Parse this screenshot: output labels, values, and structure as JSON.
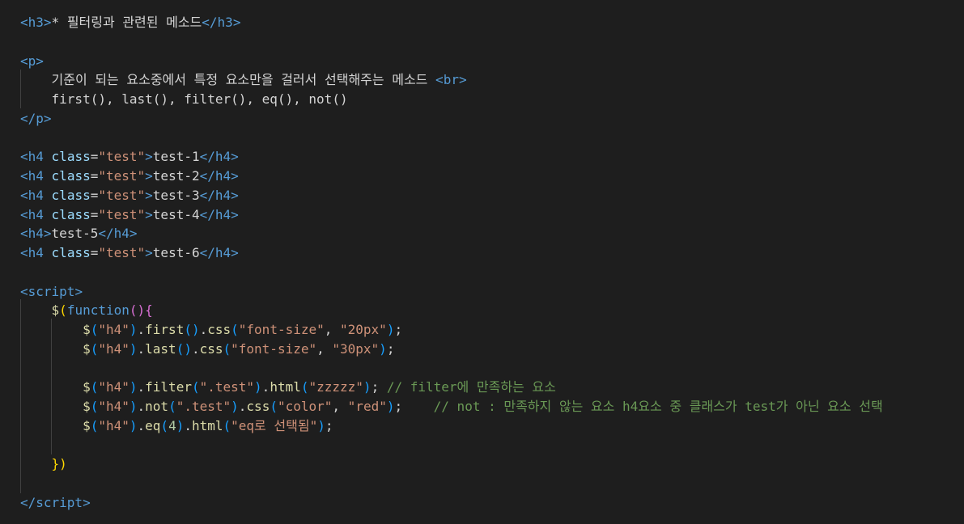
{
  "editor": {
    "lines": [
      {
        "segments": [
          {
            "t": "<",
            "c": "tag"
          },
          {
            "t": "h3",
            "c": "tag"
          },
          {
            "t": ">",
            "c": "tag"
          },
          {
            "t": "* 필터링과 관련된 메소드",
            "c": "txt"
          },
          {
            "t": "</",
            "c": "tag"
          },
          {
            "t": "h3",
            "c": "tag"
          },
          {
            "t": ">",
            "c": "tag"
          }
        ]
      },
      {
        "segments": []
      },
      {
        "segments": [
          {
            "t": "<",
            "c": "tag"
          },
          {
            "t": "p",
            "c": "tag"
          },
          {
            "t": ">",
            "c": "tag"
          }
        ]
      },
      {
        "segments": [
          {
            "t": "    기준이 되는 요소중에서 특정 요소만을 걸러서 선택해주는 메소드 ",
            "c": "txt"
          },
          {
            "t": "<",
            "c": "tag"
          },
          {
            "t": "br",
            "c": "tag"
          },
          {
            "t": ">",
            "c": "tag"
          }
        ]
      },
      {
        "segments": [
          {
            "t": "    first(), last(), filter(), eq(), not()",
            "c": "txt"
          }
        ]
      },
      {
        "segments": [
          {
            "t": "</",
            "c": "tag"
          },
          {
            "t": "p",
            "c": "tag"
          },
          {
            "t": ">",
            "c": "tag"
          }
        ]
      },
      {
        "segments": []
      },
      {
        "segments": [
          {
            "t": "<",
            "c": "tag"
          },
          {
            "t": "h4",
            "c": "tag"
          },
          {
            "t": " ",
            "c": "txt"
          },
          {
            "t": "class",
            "c": "attr"
          },
          {
            "t": "=",
            "c": "txt"
          },
          {
            "t": "\"test\"",
            "c": "str"
          },
          {
            "t": ">",
            "c": "tag"
          },
          {
            "t": "test-1",
            "c": "txt"
          },
          {
            "t": "</",
            "c": "tag"
          },
          {
            "t": "h4",
            "c": "tag"
          },
          {
            "t": ">",
            "c": "tag"
          }
        ]
      },
      {
        "segments": [
          {
            "t": "<",
            "c": "tag"
          },
          {
            "t": "h4",
            "c": "tag"
          },
          {
            "t": " ",
            "c": "txt"
          },
          {
            "t": "class",
            "c": "attr"
          },
          {
            "t": "=",
            "c": "txt"
          },
          {
            "t": "\"test\"",
            "c": "str"
          },
          {
            "t": ">",
            "c": "tag"
          },
          {
            "t": "test-2",
            "c": "txt"
          },
          {
            "t": "</",
            "c": "tag"
          },
          {
            "t": "h4",
            "c": "tag"
          },
          {
            "t": ">",
            "c": "tag"
          }
        ]
      },
      {
        "segments": [
          {
            "t": "<",
            "c": "tag"
          },
          {
            "t": "h4",
            "c": "tag"
          },
          {
            "t": " ",
            "c": "txt"
          },
          {
            "t": "class",
            "c": "attr"
          },
          {
            "t": "=",
            "c": "txt"
          },
          {
            "t": "\"test\"",
            "c": "str"
          },
          {
            "t": ">",
            "c": "tag"
          },
          {
            "t": "test-3",
            "c": "txt"
          },
          {
            "t": "</",
            "c": "tag"
          },
          {
            "t": "h4",
            "c": "tag"
          },
          {
            "t": ">",
            "c": "tag"
          }
        ]
      },
      {
        "segments": [
          {
            "t": "<",
            "c": "tag"
          },
          {
            "t": "h4",
            "c": "tag"
          },
          {
            "t": " ",
            "c": "txt"
          },
          {
            "t": "class",
            "c": "attr"
          },
          {
            "t": "=",
            "c": "txt"
          },
          {
            "t": "\"test\"",
            "c": "str"
          },
          {
            "t": ">",
            "c": "tag"
          },
          {
            "t": "test-4",
            "c": "txt"
          },
          {
            "t": "</",
            "c": "tag"
          },
          {
            "t": "h4",
            "c": "tag"
          },
          {
            "t": ">",
            "c": "tag"
          }
        ]
      },
      {
        "segments": [
          {
            "t": "<",
            "c": "tag"
          },
          {
            "t": "h4",
            "c": "tag"
          },
          {
            "t": ">",
            "c": "tag"
          },
          {
            "t": "test-5",
            "c": "txt"
          },
          {
            "t": "</",
            "c": "tag"
          },
          {
            "t": "h4",
            "c": "tag"
          },
          {
            "t": ">",
            "c": "tag"
          }
        ]
      },
      {
        "segments": [
          {
            "t": "<",
            "c": "tag"
          },
          {
            "t": "h4",
            "c": "tag"
          },
          {
            "t": " ",
            "c": "txt"
          },
          {
            "t": "class",
            "c": "attr"
          },
          {
            "t": "=",
            "c": "txt"
          },
          {
            "t": "\"test\"",
            "c": "str"
          },
          {
            "t": ">",
            "c": "tag"
          },
          {
            "t": "test-6",
            "c": "txt"
          },
          {
            "t": "</",
            "c": "tag"
          },
          {
            "t": "h4",
            "c": "tag"
          },
          {
            "t": ">",
            "c": "tag"
          }
        ]
      },
      {
        "segments": []
      },
      {
        "segments": [
          {
            "t": "<",
            "c": "tag"
          },
          {
            "t": "script",
            "c": "tag"
          },
          {
            "t": ">",
            "c": "tag"
          }
        ]
      },
      {
        "segments": [
          {
            "t": "    ",
            "c": "txt"
          },
          {
            "t": "$",
            "c": "fn"
          },
          {
            "t": "(",
            "c": "p1"
          },
          {
            "t": "function",
            "c": "kw"
          },
          {
            "t": "()",
            "c": "p2"
          },
          {
            "t": "{",
            "c": "p2"
          }
        ]
      },
      {
        "segments": [
          {
            "t": "        ",
            "c": "txt"
          },
          {
            "t": "$",
            "c": "fn"
          },
          {
            "t": "(",
            "c": "p3"
          },
          {
            "t": "\"h4\"",
            "c": "str"
          },
          {
            "t": ")",
            "c": "p3"
          },
          {
            "t": ".",
            "c": "op"
          },
          {
            "t": "first",
            "c": "fn"
          },
          {
            "t": "()",
            "c": "p3"
          },
          {
            "t": ".",
            "c": "op"
          },
          {
            "t": "css",
            "c": "fn"
          },
          {
            "t": "(",
            "c": "p3"
          },
          {
            "t": "\"font-size\"",
            "c": "str"
          },
          {
            "t": ", ",
            "c": "op"
          },
          {
            "t": "\"20px\"",
            "c": "str"
          },
          {
            "t": ")",
            "c": "p3"
          },
          {
            "t": ";",
            "c": "op"
          }
        ]
      },
      {
        "segments": [
          {
            "t": "        ",
            "c": "txt"
          },
          {
            "t": "$",
            "c": "fn"
          },
          {
            "t": "(",
            "c": "p3"
          },
          {
            "t": "\"h4\"",
            "c": "str"
          },
          {
            "t": ")",
            "c": "p3"
          },
          {
            "t": ".",
            "c": "op"
          },
          {
            "t": "last",
            "c": "fn"
          },
          {
            "t": "()",
            "c": "p3"
          },
          {
            "t": ".",
            "c": "op"
          },
          {
            "t": "css",
            "c": "fn"
          },
          {
            "t": "(",
            "c": "p3"
          },
          {
            "t": "\"font-size\"",
            "c": "str"
          },
          {
            "t": ", ",
            "c": "op"
          },
          {
            "t": "\"30px\"",
            "c": "str"
          },
          {
            "t": ")",
            "c": "p3"
          },
          {
            "t": ";",
            "c": "op"
          }
        ]
      },
      {
        "segments": []
      },
      {
        "segments": [
          {
            "t": "        ",
            "c": "txt"
          },
          {
            "t": "$",
            "c": "fn"
          },
          {
            "t": "(",
            "c": "p3"
          },
          {
            "t": "\"h4\"",
            "c": "str"
          },
          {
            "t": ")",
            "c": "p3"
          },
          {
            "t": ".",
            "c": "op"
          },
          {
            "t": "filter",
            "c": "fn"
          },
          {
            "t": "(",
            "c": "p3"
          },
          {
            "t": "\".test\"",
            "c": "str"
          },
          {
            "t": ")",
            "c": "p3"
          },
          {
            "t": ".",
            "c": "op"
          },
          {
            "t": "html",
            "c": "fn"
          },
          {
            "t": "(",
            "c": "p3"
          },
          {
            "t": "\"zzzzz\"",
            "c": "str"
          },
          {
            "t": ")",
            "c": "p3"
          },
          {
            "t": "; ",
            "c": "op"
          },
          {
            "t": "// filter에 만족하는 요소",
            "c": "cmt"
          }
        ]
      },
      {
        "segments": [
          {
            "t": "        ",
            "c": "txt"
          },
          {
            "t": "$",
            "c": "fn"
          },
          {
            "t": "(",
            "c": "p3"
          },
          {
            "t": "\"h4\"",
            "c": "str"
          },
          {
            "t": ")",
            "c": "p3"
          },
          {
            "t": ".",
            "c": "op"
          },
          {
            "t": "not",
            "c": "fn"
          },
          {
            "t": "(",
            "c": "p3"
          },
          {
            "t": "\".test\"",
            "c": "str"
          },
          {
            "t": ")",
            "c": "p3"
          },
          {
            "t": ".",
            "c": "op"
          },
          {
            "t": "css",
            "c": "fn"
          },
          {
            "t": "(",
            "c": "p3"
          },
          {
            "t": "\"color\"",
            "c": "str"
          },
          {
            "t": ", ",
            "c": "op"
          },
          {
            "t": "\"red\"",
            "c": "str"
          },
          {
            "t": ")",
            "c": "p3"
          },
          {
            "t": ";    ",
            "c": "op"
          },
          {
            "t": "// not : 만족하지 않는 요소 h4요소 중 클래스가 test가 아닌 요소 선택",
            "c": "cmt"
          }
        ]
      },
      {
        "segments": [
          {
            "t": "        ",
            "c": "txt"
          },
          {
            "t": "$",
            "c": "fn"
          },
          {
            "t": "(",
            "c": "p3"
          },
          {
            "t": "\"h4\"",
            "c": "str"
          },
          {
            "t": ")",
            "c": "p3"
          },
          {
            "t": ".",
            "c": "op"
          },
          {
            "t": "eq",
            "c": "fn"
          },
          {
            "t": "(",
            "c": "p3"
          },
          {
            "t": "4",
            "c": "num"
          },
          {
            "t": ")",
            "c": "p3"
          },
          {
            "t": ".",
            "c": "op"
          },
          {
            "t": "html",
            "c": "fn"
          },
          {
            "t": "(",
            "c": "p3"
          },
          {
            "t": "\"eq로 선택됨\"",
            "c": "str"
          },
          {
            "t": ")",
            "c": "p3"
          },
          {
            "t": ";",
            "c": "op"
          }
        ]
      },
      {
        "segments": []
      },
      {
        "segments": [
          {
            "t": "    ",
            "c": "txt"
          },
          {
            "t": "})",
            "c": "p1"
          }
        ]
      },
      {
        "segments": []
      },
      {
        "segments": [
          {
            "t": "</",
            "c": "tag"
          },
          {
            "t": "script",
            "c": "tag"
          },
          {
            "t": ">",
            "c": "tag"
          }
        ]
      }
    ]
  }
}
